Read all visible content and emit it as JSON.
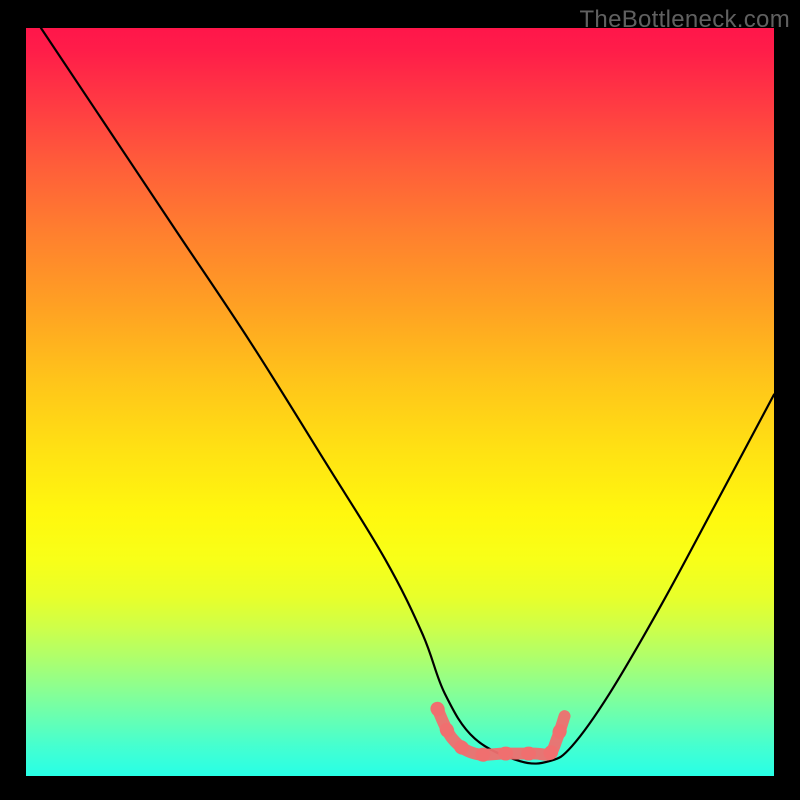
{
  "watermark": "TheBottleneck.com",
  "chart_data": {
    "type": "line",
    "title": "",
    "xlabel": "",
    "ylabel": "",
    "xlim": [
      0,
      100
    ],
    "ylim": [
      0,
      100
    ],
    "series": [
      {
        "name": "bottleneck-curve",
        "x": [
          2,
          10,
          20,
          30,
          40,
          48,
          53,
          56,
          60,
          66,
          70,
          73,
          78,
          85,
          92,
          100
        ],
        "values": [
          100,
          88,
          73,
          58,
          42,
          29,
          19,
          11,
          5,
          2,
          2,
          4,
          11,
          23,
          36,
          51
        ]
      },
      {
        "name": "optimal-range-marker",
        "x": [
          55,
          57,
          60,
          64,
          68,
          70,
          71,
          72
        ],
        "values": [
          9,
          5,
          3,
          3,
          3,
          3,
          5,
          8
        ]
      }
    ],
    "colors": {
      "curve": "#000000",
      "marker": "#ef6f6f",
      "gradient_top": "#ff164a",
      "gradient_bottom": "#28ffe6"
    }
  }
}
